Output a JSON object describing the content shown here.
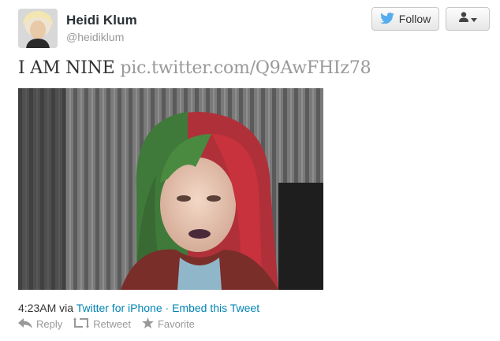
{
  "user": {
    "name": "Heidi Klum",
    "handle": "@heidiklum"
  },
  "buttons": {
    "follow_label": "Follow"
  },
  "tweet": {
    "text": "I AM NINE",
    "link": "pic.twitter.com/Q9AwFHIz78"
  },
  "meta": {
    "time": "4:23AM",
    "via_word": "via",
    "client": "Twitter for iPhone",
    "separator": "·",
    "embed": "Embed this Tweet"
  },
  "actions": [
    {
      "label": "Reply",
      "icon": "reply-icon"
    },
    {
      "label": "Retweet",
      "icon": "retweet-icon"
    },
    {
      "label": "Favorite",
      "icon": "star-icon"
    }
  ],
  "colors": {
    "link": "#0084b4",
    "twitter_blue": "#55acee",
    "muted": "#999999"
  }
}
